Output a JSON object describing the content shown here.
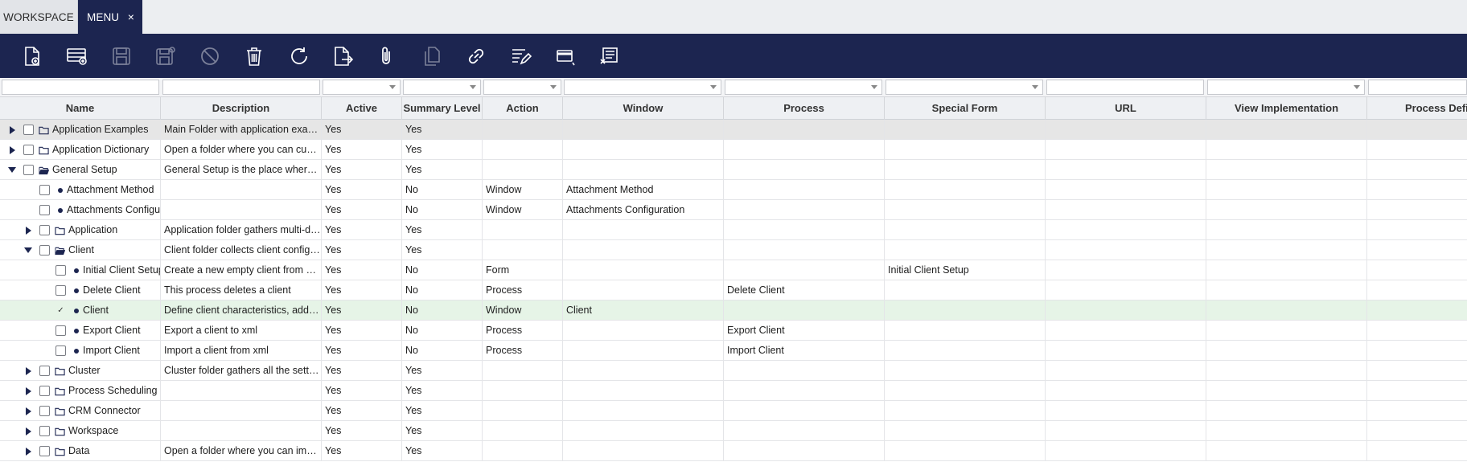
{
  "tabs": [
    {
      "label": "WORKSPACE",
      "active": false
    },
    {
      "label": "MENU",
      "active": true,
      "close": "×"
    }
  ],
  "toolbar": {
    "buttons": [
      {
        "name": "new-document-icon",
        "disabled": false
      },
      {
        "name": "new-record-icon",
        "disabled": false
      },
      {
        "name": "save-icon",
        "disabled": true
      },
      {
        "name": "save-and-new-icon",
        "disabled": true
      },
      {
        "name": "undo-cancel-icon",
        "disabled": true
      },
      {
        "name": "delete-icon",
        "disabled": false
      },
      {
        "name": "refresh-icon",
        "disabled": false
      },
      {
        "name": "export-icon",
        "disabled": false
      },
      {
        "name": "attachment-icon",
        "disabled": false
      },
      {
        "name": "copy-icon",
        "disabled": true
      },
      {
        "name": "link-icon",
        "disabled": false
      },
      {
        "name": "edit-columns-icon",
        "disabled": false
      },
      {
        "name": "form-view-icon",
        "disabled": false
      },
      {
        "name": "notes-icon",
        "disabled": false
      }
    ]
  },
  "columns": [
    "Name",
    "Description",
    "Active",
    "Summary Level",
    "Action",
    "Window",
    "Process",
    "Special Form",
    "URL",
    "View Implementation",
    "Process Definition"
  ],
  "rows": [
    {
      "level": 0,
      "expander": "right",
      "folder": "closed",
      "name": "Application Examples",
      "description": "Main Folder with application examples",
      "active": "Yes",
      "summary": "Yes",
      "action": "",
      "window": "",
      "process": "",
      "special_form": "",
      "url": "",
      "view_impl": "",
      "process_def": "",
      "state": "hl"
    },
    {
      "level": 0,
      "expander": "right",
      "folder": "closed",
      "name": "Application Dictionary",
      "description": "Open a folder where you can customize the application",
      "active": "Yes",
      "summary": "Yes",
      "action": "",
      "window": "",
      "process": "",
      "special_form": "",
      "url": "",
      "view_impl": "",
      "process_def": ""
    },
    {
      "level": 0,
      "expander": "down",
      "folder": "open",
      "name": "General Setup",
      "description": "General Setup is the place where you define",
      "active": "Yes",
      "summary": "Yes",
      "action": "",
      "window": "",
      "process": "",
      "special_form": "",
      "url": "",
      "view_impl": "",
      "process_def": ""
    },
    {
      "level": 1,
      "expander": "",
      "folder": "bullet",
      "name": "Attachment Method",
      "description": "",
      "active": "Yes",
      "summary": "No",
      "action": "Window",
      "window": "Attachment Method",
      "process": "",
      "special_form": "",
      "url": "",
      "view_impl": "",
      "process_def": ""
    },
    {
      "level": 1,
      "expander": "",
      "folder": "bullet",
      "name": "Attachments Configuration",
      "description": "",
      "active": "Yes",
      "summary": "No",
      "action": "Window",
      "window": "Attachments Configuration",
      "process": "",
      "special_form": "",
      "url": "",
      "view_impl": "",
      "process_def": ""
    },
    {
      "level": 1,
      "expander": "right",
      "folder": "closed",
      "name": "Application",
      "description": "Application folder gathers multi-dimension settings",
      "active": "Yes",
      "summary": "Yes",
      "action": "",
      "window": "",
      "process": "",
      "special_form": "",
      "url": "",
      "view_impl": "",
      "process_def": ""
    },
    {
      "level": 1,
      "expander": "down",
      "folder": "open",
      "name": "Client",
      "description": "Client folder collects client configuration",
      "active": "Yes",
      "summary": "Yes",
      "action": "",
      "window": "",
      "process": "",
      "special_form": "",
      "url": "",
      "view_impl": "",
      "process_def": ""
    },
    {
      "level": 2,
      "expander": "",
      "folder": "bullet",
      "name": "Initial Client Setup",
      "description": "Create a new empty client from scratch",
      "active": "Yes",
      "summary": "No",
      "action": "Form",
      "window": "",
      "process": "",
      "special_form": "Initial Client Setup",
      "url": "",
      "view_impl": "",
      "process_def": ""
    },
    {
      "level": 2,
      "expander": "",
      "folder": "bullet",
      "name": "Delete Client",
      "description": "This process deletes a client",
      "active": "Yes",
      "summary": "No",
      "action": "Process",
      "window": "",
      "process": "Delete Client",
      "special_form": "",
      "url": "",
      "view_impl": "",
      "process_def": ""
    },
    {
      "level": 2,
      "expander": "",
      "folder": "bullet",
      "name": "Client",
      "description": "Define client characteristics, additional info",
      "active": "Yes",
      "summary": "No",
      "action": "Window",
      "window": "Client",
      "process": "",
      "special_form": "",
      "url": "",
      "view_impl": "",
      "process_def": "",
      "state": "sel",
      "checked": true
    },
    {
      "level": 2,
      "expander": "",
      "folder": "bullet",
      "name": "Export Client",
      "description": "Export a client to xml",
      "active": "Yes",
      "summary": "No",
      "action": "Process",
      "window": "",
      "process": "Export Client",
      "special_form": "",
      "url": "",
      "view_impl": "",
      "process_def": ""
    },
    {
      "level": 2,
      "expander": "",
      "folder": "bullet",
      "name": "Import Client",
      "description": "Import a client from xml",
      "active": "Yes",
      "summary": "No",
      "action": "Process",
      "window": "",
      "process": "Import Client",
      "special_form": "",
      "url": "",
      "view_impl": "",
      "process_def": ""
    },
    {
      "level": 1,
      "expander": "right",
      "folder": "closed",
      "name": "Cluster",
      "description": "Cluster folder gathers all the settings",
      "active": "Yes",
      "summary": "Yes",
      "action": "",
      "window": "",
      "process": "",
      "special_form": "",
      "url": "",
      "view_impl": "",
      "process_def": ""
    },
    {
      "level": 1,
      "expander": "right",
      "folder": "closed",
      "name": "Process Scheduling",
      "description": "",
      "active": "Yes",
      "summary": "Yes",
      "action": "",
      "window": "",
      "process": "",
      "special_form": "",
      "url": "",
      "view_impl": "",
      "process_def": ""
    },
    {
      "level": 1,
      "expander": "right",
      "folder": "closed",
      "name": "CRM Connector",
      "description": "",
      "active": "Yes",
      "summary": "Yes",
      "action": "",
      "window": "",
      "process": "",
      "special_form": "",
      "url": "",
      "view_impl": "",
      "process_def": ""
    },
    {
      "level": 1,
      "expander": "right",
      "folder": "closed",
      "name": "Workspace",
      "description": "",
      "active": "Yes",
      "summary": "Yes",
      "action": "",
      "window": "",
      "process": "",
      "special_form": "",
      "url": "",
      "view_impl": "",
      "process_def": ""
    },
    {
      "level": 1,
      "expander": "right",
      "folder": "closed",
      "name": "Data",
      "description": "Open a folder where you can import data",
      "active": "Yes",
      "summary": "Yes",
      "action": "",
      "window": "",
      "process": "",
      "special_form": "",
      "url": "",
      "view_impl": "",
      "process_def": ""
    }
  ]
}
